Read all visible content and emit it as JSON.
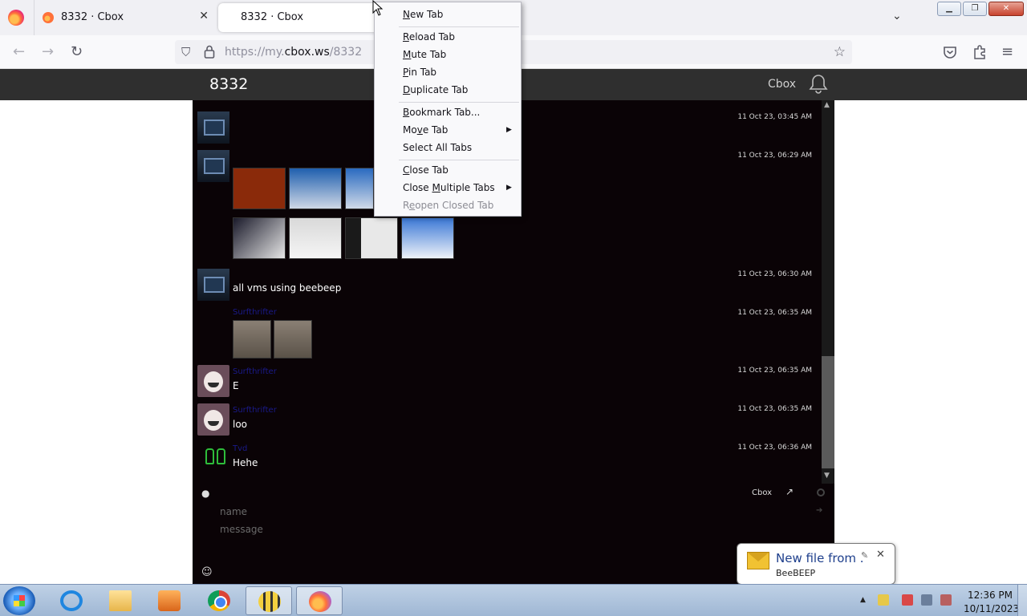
{
  "browser": {
    "tabs": [
      {
        "title": "8332 · Cbox",
        "close": "✕"
      },
      {
        "title": "8332 · Cbox"
      }
    ],
    "url_prefix": "https://my.",
    "url_host": "cbox.ws",
    "url_path": "/8332"
  },
  "header": {
    "title": "8332",
    "brand": "Cbox"
  },
  "messages": [
    {
      "time": "11 Oct 23, 03:45 AM",
      "name": "",
      "text": ""
    },
    {
      "time": "11 Oct 23, 06:29 AM",
      "name": "",
      "text": ""
    },
    {
      "time": "11 Oct 23, 06:30 AM",
      "name": "",
      "text": "all vms using beebeep"
    },
    {
      "time": "11 Oct 23, 06:35 AM",
      "name": "Surfthrifter",
      "text": ""
    },
    {
      "time": "11 Oct 23, 06:35 AM",
      "name": "Surfthrifter",
      "text": "E"
    },
    {
      "time": "11 Oct 23, 06:35 AM",
      "name": "Surfthrifter",
      "text": "loo"
    },
    {
      "time": "11 Oct 23, 06:36 AM",
      "name": "Tvd",
      "text": "Hehe"
    }
  ],
  "form": {
    "brand": "Cbox",
    "name_placeholder": "name",
    "message_placeholder": "message"
  },
  "context_menu": {
    "items": [
      {
        "pre": "",
        "key": "N",
        "post": "ew Tab"
      },
      {
        "pre": "",
        "key": "R",
        "post": "eload Tab"
      },
      {
        "pre": "",
        "key": "M",
        "post": "ute Tab"
      },
      {
        "pre": "",
        "key": "P",
        "post": "in Tab"
      },
      {
        "pre": "",
        "key": "D",
        "post": "uplicate Tab"
      },
      {
        "pre": "",
        "key": "B",
        "post": "ookmark Tab..."
      },
      {
        "pre": "Mo",
        "key": "v",
        "post": "e Tab"
      },
      {
        "pre": "Select All Tabs",
        "key": "",
        "post": ""
      },
      {
        "pre": "",
        "key": "C",
        "post": "lose Tab"
      },
      {
        "pre": "Close ",
        "key": "M",
        "post": "ultiple Tabs"
      },
      {
        "pre": "R",
        "key": "e",
        "post": "open Closed Tab"
      }
    ]
  },
  "notification": {
    "title": "New file from .",
    "subtitle": "BeeBEEP"
  },
  "taskbar": {
    "time": "12:36 PM",
    "date": "10/11/2023"
  },
  "colors": {
    "chat_bg": "#0a0306",
    "header_bg": "#2f2f2f",
    "name_color": "#1a1a8a",
    "menu_bg": "#f9f9fb"
  }
}
